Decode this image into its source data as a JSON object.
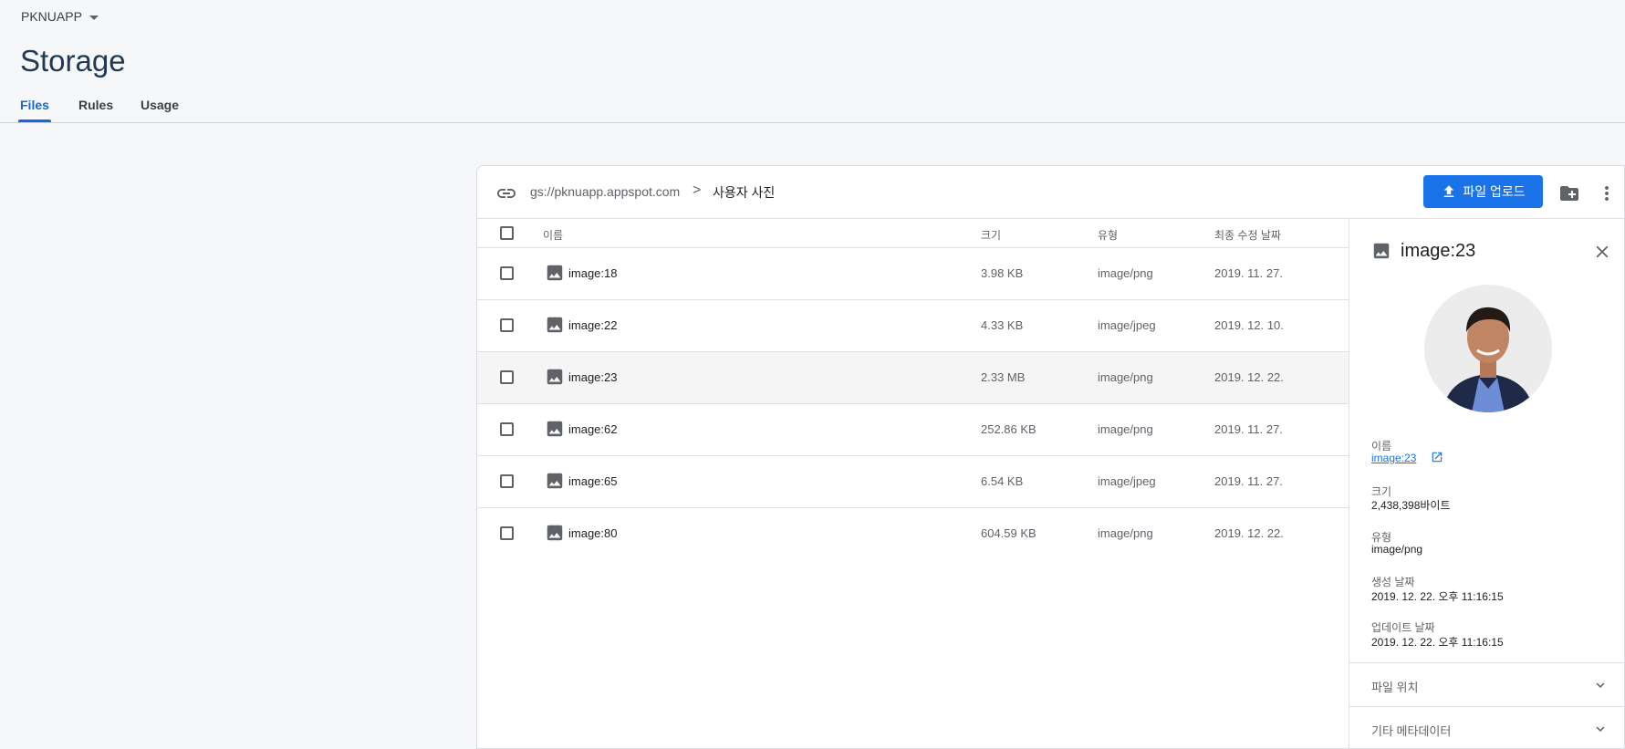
{
  "header": {
    "project": "PKNUAPP",
    "title": "Storage",
    "tabs": [
      {
        "label": "Files"
      },
      {
        "label": "Rules"
      },
      {
        "label": "Usage"
      }
    ]
  },
  "toolbar": {
    "bucket": "gs://pknuapp.appspot.com",
    "separator": ">",
    "current_folder": "사용자 사진",
    "upload_label": "파일 업로드"
  },
  "table": {
    "headers": {
      "name": "이름",
      "size": "크기",
      "type": "유형",
      "modified": "최종 수정 날짜"
    },
    "rows": [
      {
        "name": "image:18",
        "size": "3.98 KB",
        "type": "image/png",
        "modified": "2019. 11. 27."
      },
      {
        "name": "image:22",
        "size": "4.33 KB",
        "type": "image/jpeg",
        "modified": "2019. 12. 10."
      },
      {
        "name": "image:23",
        "size": "2.33 MB",
        "type": "image/png",
        "modified": "2019. 12. 22."
      },
      {
        "name": "image:62",
        "size": "252.86 KB",
        "type": "image/png",
        "modified": "2019. 11. 27."
      },
      {
        "name": "image:65",
        "size": "6.54 KB",
        "type": "image/jpeg",
        "modified": "2019. 11. 27."
      },
      {
        "name": "image:80",
        "size": "604.59 KB",
        "type": "image/png",
        "modified": "2019. 12. 22."
      }
    ]
  },
  "detail": {
    "title": "image:23",
    "name_label": "이름",
    "name_value": "image:23",
    "size_label": "크기",
    "size_value": "2,438,398바이트",
    "type_label": "유형",
    "type_value": "image/png",
    "created_label": "생성 날짜",
    "created_value": "2019. 12. 22. 오후 11:16:15",
    "updated_label": "업데이트 날짜",
    "updated_value": "2019. 12. 22. 오후 11:16:15",
    "file_location_label": "파일 위치",
    "other_metadata_label": "기타 메타데이터"
  },
  "colors": {
    "accent": "#1a73e8",
    "tab_active": "#1967d2",
    "background": "#f5f7f9"
  },
  "icons": [
    "link-icon",
    "upload-icon",
    "folder-add-icon",
    "more-vert-icon",
    "image-icon",
    "close-icon",
    "open-in-new-icon",
    "chevron-down-icon",
    "caret-down-icon"
  ]
}
